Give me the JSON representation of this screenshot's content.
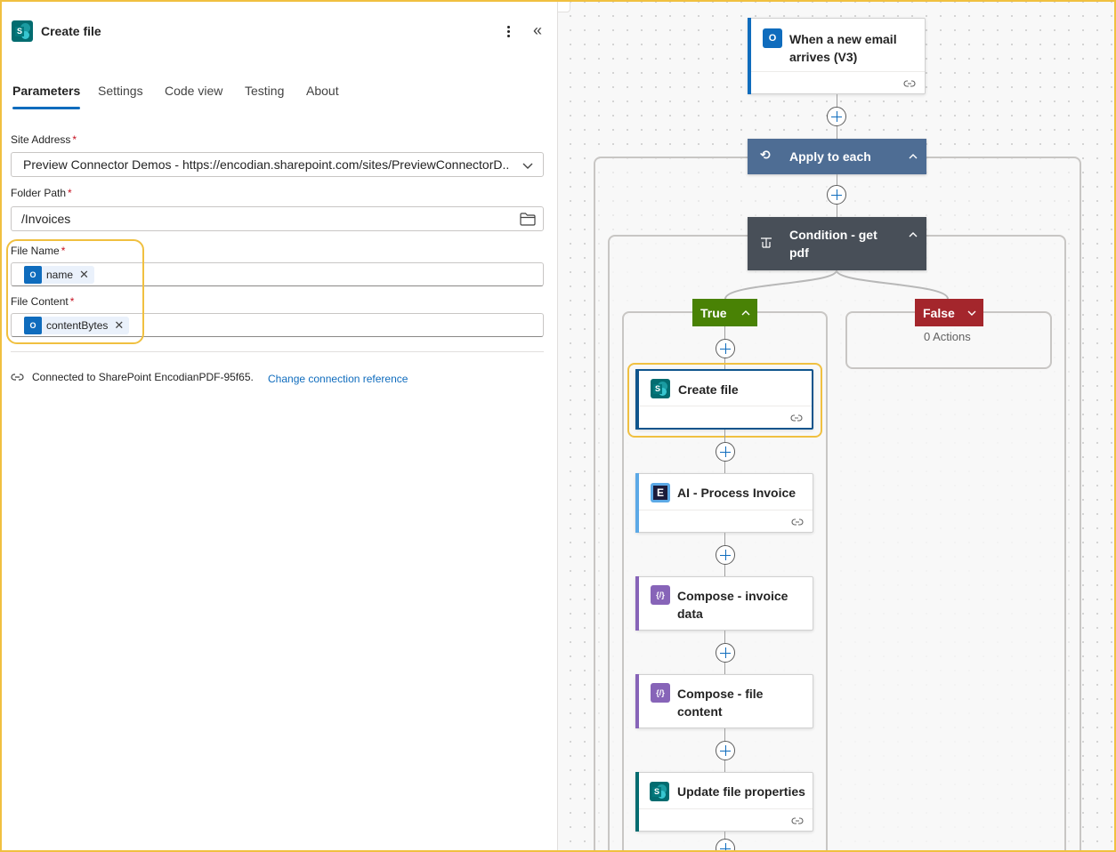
{
  "panel": {
    "title": "Create file",
    "icon": "sharepoint-icon",
    "tabs": [
      {
        "label": "Parameters",
        "active": true
      },
      {
        "label": "Settings",
        "active": false
      },
      {
        "label": "Code view",
        "active": false
      },
      {
        "label": "Testing",
        "active": false
      },
      {
        "label": "About",
        "active": false
      }
    ],
    "fields": {
      "site_address": {
        "label": "Site Address",
        "required": "*",
        "value": "Preview Connector Demos - https://encodian.sharepoint.com/sites/PreviewConnectorD..."
      },
      "folder_path": {
        "label": "Folder Path",
        "required": "*",
        "value": "/Invoices"
      },
      "file_name": {
        "label": "File Name",
        "required": "*",
        "token": "name"
      },
      "file_content": {
        "label": "File Content",
        "required": "*",
        "token": "contentBytes"
      }
    },
    "connection": {
      "text": "Connected to SharePoint EncodianPDF-95f65.",
      "link": "Change connection reference"
    }
  },
  "canvas": {
    "collapse_label": "Collapse",
    "trigger": {
      "title": "When a new email arrives (V3)",
      "icon": "outlook-icon"
    },
    "apply_each": {
      "title": "Apply to each",
      "color": "#4e6d94"
    },
    "condition": {
      "title": "Condition - get pdf",
      "color": "#484f58"
    },
    "true_branch": {
      "label": "True",
      "color": "#498205"
    },
    "false_branch": {
      "label": "False",
      "color": "#a4262c",
      "empty_text": "0 Actions"
    },
    "actions": [
      {
        "title": "Create file",
        "icon": "sharepoint-icon",
        "accent": "#036c70"
      },
      {
        "title": "AI - Process Invoice",
        "icon": "encodian-icon",
        "accent": "#5ca9e6"
      },
      {
        "title": "Compose - invoice data",
        "icon": "compose-icon",
        "accent": "#8764b8"
      },
      {
        "title": "Compose - file content",
        "icon": "compose-icon",
        "accent": "#8764b8"
      },
      {
        "title": "Update file properties",
        "icon": "sharepoint-icon",
        "accent": "#036c70"
      }
    ],
    "highlight_color": "#f0c040"
  }
}
